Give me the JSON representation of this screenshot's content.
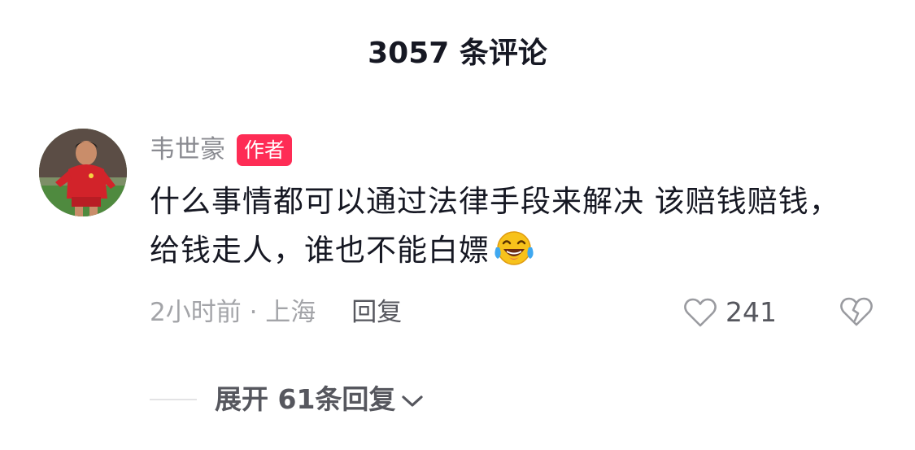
{
  "header": {
    "title": "3057 条评论"
  },
  "comment": {
    "author_name": "韦世豪",
    "author_badge": "作者",
    "text": "什么事情都可以通过法律手段来解决 该赔钱赔钱，给钱走人，谁也不能白嫖",
    "emoji": "laughing-tears-emoji",
    "meta_time": "2小时前 · 上海",
    "reply_label": "回复",
    "like_count": "241"
  },
  "replies": {
    "expand_label": "展开 61条回复"
  },
  "colors": {
    "badge": "#fe2c55",
    "muted_text": "#a3a4a8",
    "primary_text": "#161823"
  }
}
